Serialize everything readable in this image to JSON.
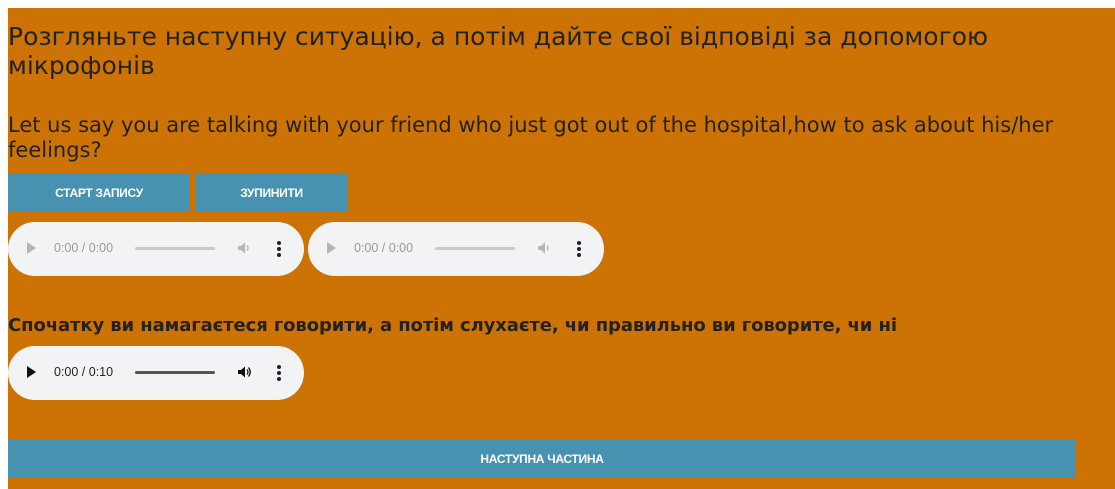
{
  "page": {
    "title": "Розгляньте наступну ситуацію, а потім дайте свої відповіді за допомогою мікрофонів",
    "question": "Let us say you are talking with your friend who just got out of the hospital,how to ask about his/her feelings?",
    "instruction": "Спочатку ви намагаєтеся говорити, а потім слухаєте, чи правильно ви говорите, чи ні",
    "background_color": "#cd7305",
    "button_color": "#4791b1"
  },
  "controls": {
    "start_label": "СТАРТ ЗАПИСУ",
    "stop_label": "ЗУПИНИТИ",
    "next_label": "НАСТУПНА ЧАСТИНА"
  },
  "players": [
    {
      "time": "0:00 / 0:00",
      "enabled": false,
      "icons": [
        "play-icon",
        "volume-icon",
        "more-options-icon"
      ]
    },
    {
      "time": "0:00 / 0:00",
      "enabled": false,
      "icons": [
        "play-icon",
        "volume-icon",
        "more-options-icon"
      ]
    },
    {
      "time": "0:00 / 0:10",
      "enabled": true,
      "icons": [
        "play-icon",
        "volume-icon",
        "more-options-icon"
      ]
    }
  ]
}
